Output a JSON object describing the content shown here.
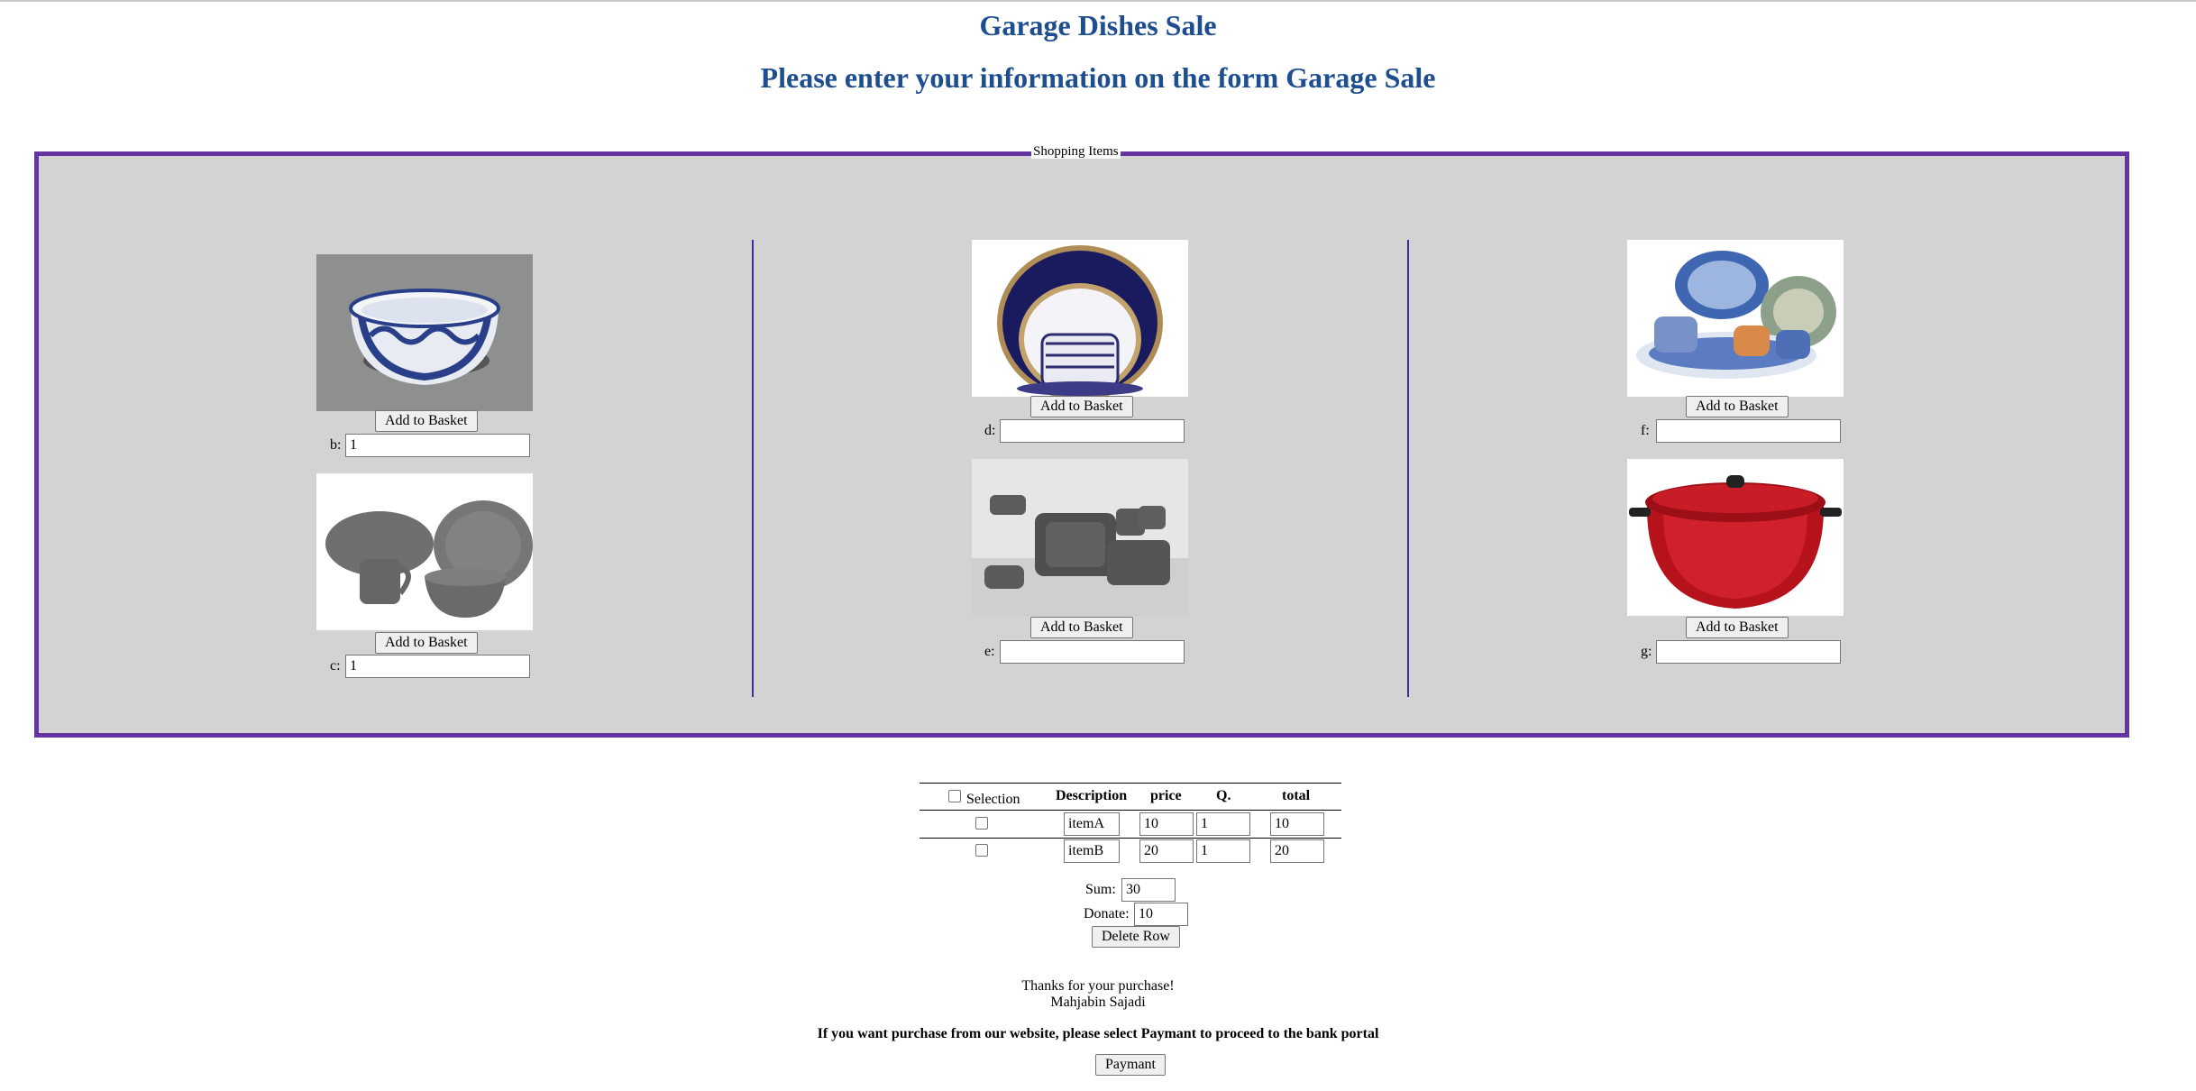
{
  "header": {
    "title": "Garage Dishes Sale",
    "subtitle": "Please enter your information on the form Garage Sale"
  },
  "shopping": {
    "legend": "Shopping Items",
    "add_label": "Add to Basket",
    "items": [
      {
        "label": "b:",
        "value": "1",
        "image": "blue-white-bowl"
      },
      {
        "label": "c:",
        "value": "1",
        "image": "gray-dinnerware-set"
      },
      {
        "label": "d:",
        "value": "",
        "image": "navy-gold-plate-set"
      },
      {
        "label": "e:",
        "value": "",
        "image": "square-gray-dish-set"
      },
      {
        "label": "f:",
        "value": "",
        "image": "blue-patterned-dish-set"
      },
      {
        "label": "g:",
        "value": "",
        "image": "red-stock-pot"
      }
    ]
  },
  "basket": {
    "headers": {
      "selection": "Selection",
      "description": "Description",
      "price": "price",
      "qty": "Q.",
      "total": "total"
    },
    "rows": [
      {
        "description": "itemA",
        "price": "10",
        "qty": "1",
        "total": "10"
      },
      {
        "description": "itemB",
        "price": "20",
        "qty": "1",
        "total": "20"
      }
    ],
    "sum_label": "Sum:",
    "sum_value": "30",
    "donate_label": "Donate:",
    "donate_value": "10",
    "delete_label": "Delete Row"
  },
  "footer": {
    "thanks": "Thanks for your purchase!",
    "author": "Mahjabin Sajadi",
    "notice": "If you want purchase from our website, please select Paymant to proceed to the bank portal",
    "payment_label": "Paymant"
  },
  "colors": {
    "heading": "#1d4e8f",
    "fieldset_border": "#6434a0",
    "fieldset_bg": "#d3d3d3",
    "divider": "#3a2fa0"
  }
}
